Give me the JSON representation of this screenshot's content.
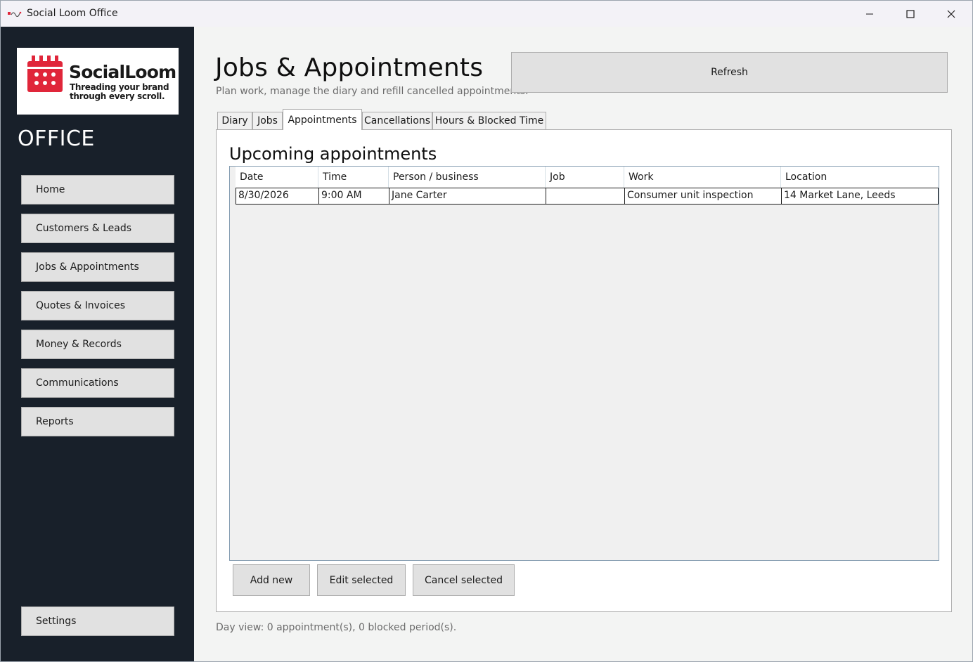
{
  "window": {
    "title": "Social Loom Office"
  },
  "brand": {
    "name": "SocialLoom",
    "tagline": "Threading your brand through every scroll.",
    "accent": "#e0263a",
    "section": "OFFICE"
  },
  "nav": {
    "items": [
      {
        "label": "Home"
      },
      {
        "label": "Customers & Leads"
      },
      {
        "label": "Jobs & Appointments"
      },
      {
        "label": "Quotes & Invoices"
      },
      {
        "label": "Money & Records"
      },
      {
        "label": "Communications"
      },
      {
        "label": "Reports"
      }
    ],
    "settings_label": "Settings"
  },
  "page": {
    "title": "Jobs & Appointments",
    "subtitle": "Plan work, manage the diary and refill cancelled appointments.",
    "refresh_label": "Refresh"
  },
  "tabs": [
    {
      "label": "Diary"
    },
    {
      "label": "Jobs"
    },
    {
      "label": "Appointments"
    },
    {
      "label": "Cancellations"
    },
    {
      "label": "Hours & Blocked Time"
    }
  ],
  "active_tab": "Appointments",
  "appointments": {
    "title": "Upcoming appointments",
    "columns": [
      "Date",
      "Time",
      "Person / business",
      "Job",
      "Work",
      "Location"
    ],
    "rows": [
      [
        "8/30/2026",
        "9:00 AM",
        "Jane Carter",
        "",
        "Consumer unit inspection",
        "14 Market Lane, Leeds"
      ]
    ],
    "actions": {
      "add_label": "Add new",
      "edit_label": "Edit selected",
      "cancel_label": "Cancel selected"
    }
  },
  "status": "Day view: 0 appointment(s), 0 blocked period(s)."
}
